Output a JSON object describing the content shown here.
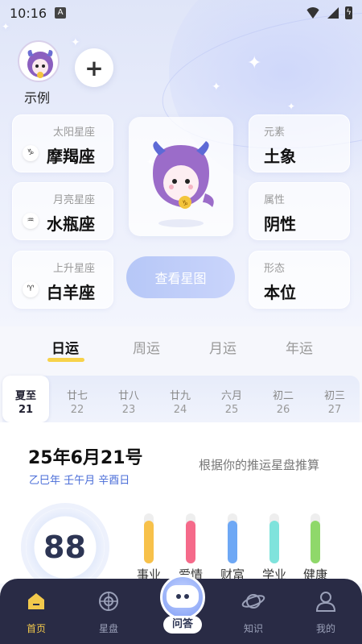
{
  "status_bar": {
    "time": "10:16",
    "notification_letter": "A"
  },
  "profile": {
    "name": "示例",
    "add_symbol": "+"
  },
  "sign_cards": [
    {
      "caption": "太阳星座",
      "value": "摩羯座",
      "glyph": "♑"
    },
    {
      "caption": "月亮星座",
      "value": "水瓶座",
      "glyph": "♒"
    },
    {
      "caption": "上升星座",
      "value": "白羊座",
      "glyph": "♈"
    }
  ],
  "attribute_cards": [
    {
      "caption": "元素",
      "value": "土象"
    },
    {
      "caption": "属性",
      "value": "阴性"
    },
    {
      "caption": "形态",
      "value": "本位"
    }
  ],
  "view_chart_button": "查看星图",
  "fortune_tabs": [
    {
      "label": "日运",
      "active": true
    },
    {
      "label": "周运",
      "active": false
    },
    {
      "label": "月运",
      "active": false
    },
    {
      "label": "年运",
      "active": false
    }
  ],
  "days": [
    {
      "lunar": "夏至",
      "date": "21",
      "active": true
    },
    {
      "lunar": "廿七",
      "date": "22"
    },
    {
      "lunar": "廿八",
      "date": "23"
    },
    {
      "lunar": "廿九",
      "date": "24"
    },
    {
      "lunar": "六月",
      "date": "25"
    },
    {
      "lunar": "初二",
      "date": "26"
    },
    {
      "lunar": "初三",
      "date": "27"
    }
  ],
  "date_panel": {
    "title": "25年6月21号",
    "ganzhi": "乙巳年 壬午月 辛酉日",
    "note": "根据你的推运星盘推算"
  },
  "overall_score": "88",
  "fortune_bars": [
    {
      "label": "事业",
      "level": 0.85,
      "color": "#f7c14a"
    },
    {
      "label": "爱情",
      "level": 0.85,
      "color": "#f56a8a"
    },
    {
      "label": "财富",
      "level": 0.85,
      "color": "#6ea8f5"
    },
    {
      "label": "学业",
      "level": 0.85,
      "color": "#7fe3dc"
    },
    {
      "label": "健康",
      "level": 0.85,
      "color": "#8fd86a"
    }
  ],
  "bottom_nav": [
    {
      "label": "首页",
      "icon": "home-icon",
      "active": true
    },
    {
      "label": "星盘",
      "icon": "astrolabe-icon"
    },
    {
      "label": "问答",
      "icon": "robot-icon",
      "center": true
    },
    {
      "label": "知识",
      "icon": "planet-icon"
    },
    {
      "label": "我的",
      "icon": "profile-icon"
    }
  ]
}
